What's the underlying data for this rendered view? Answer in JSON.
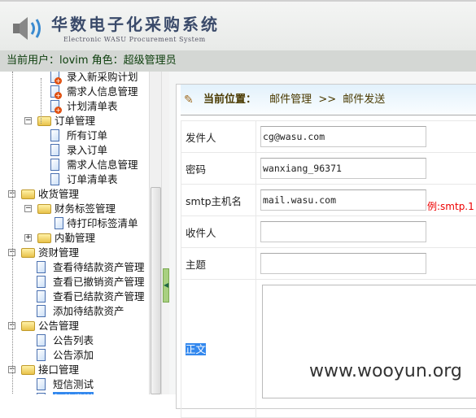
{
  "header": {
    "title": "华数电子化采购系统",
    "subtitle": "Electronic WASU Procurement System"
  },
  "userbar": {
    "text": "当前用户：lovim 角色：超级管理员"
  },
  "tree": [
    {
      "label": "录入新采购计划",
      "level": 2,
      "icon": "leaf-plus"
    },
    {
      "label": "需求人信息管理",
      "level": 2,
      "icon": "leaf-plus"
    },
    {
      "label": "计划清单表",
      "level": 2,
      "icon": "leaf-plus"
    },
    {
      "label": "订单管理",
      "level": 1,
      "icon": "folder",
      "expanded": true
    },
    {
      "label": "所有订单",
      "level": 2,
      "icon": "leaf"
    },
    {
      "label": "录入订单",
      "level": 2,
      "icon": "leaf"
    },
    {
      "label": "需求人信息管理",
      "level": 2,
      "icon": "leaf"
    },
    {
      "label": "订单清单表",
      "level": 2,
      "icon": "leaf"
    },
    {
      "label": "收货管理",
      "level": 0,
      "icon": "folder",
      "expanded": true
    },
    {
      "label": "财务标签管理",
      "level": 1,
      "icon": "folder",
      "expanded": true
    },
    {
      "label": "待打印标签清单",
      "level": 2,
      "icon": "leaf"
    },
    {
      "label": "内勤管理",
      "level": 1,
      "icon": "folder",
      "expanded": false
    },
    {
      "label": "资财管理",
      "level": 0,
      "icon": "folder",
      "expanded": true
    },
    {
      "label": "查看待结款资产管理",
      "level": 1,
      "icon": "leaf"
    },
    {
      "label": "查看已撤销资产管理",
      "level": 1,
      "icon": "leaf"
    },
    {
      "label": "查看已结款资产管理",
      "level": 1,
      "icon": "leaf"
    },
    {
      "label": "添加待结款资产",
      "level": 1,
      "icon": "leaf"
    },
    {
      "label": "公告管理",
      "level": 0,
      "icon": "folder",
      "expanded": true
    },
    {
      "label": "公告列表",
      "level": 1,
      "icon": "leaf"
    },
    {
      "label": "公告添加",
      "level": 1,
      "icon": "leaf"
    },
    {
      "label": "接口管理",
      "level": 0,
      "icon": "folder",
      "expanded": true
    },
    {
      "label": "短信测试",
      "level": 1,
      "icon": "leaf"
    },
    {
      "label": "邮件发送",
      "level": 1,
      "icon": "leaf"
    }
  ],
  "breadcrumb": {
    "label": "当前位置：",
    "path": "邮件管理",
    "sep": ">>",
    "current": "邮件发送"
  },
  "form": {
    "sender": {
      "label": "发件人",
      "value": "cg@wasu.com"
    },
    "password": {
      "label": "密码",
      "value": "wanxiang_96371"
    },
    "smtp": {
      "label": "smtp主机名",
      "value": "mail.wasu.com",
      "hint": "例:smtp.1"
    },
    "recipient": {
      "label": "收件人",
      "value": ""
    },
    "subject": {
      "label": "主题",
      "value": ""
    },
    "body": {
      "label": "正文",
      "value": ""
    }
  },
  "watermark": "www.wooyun.org"
}
